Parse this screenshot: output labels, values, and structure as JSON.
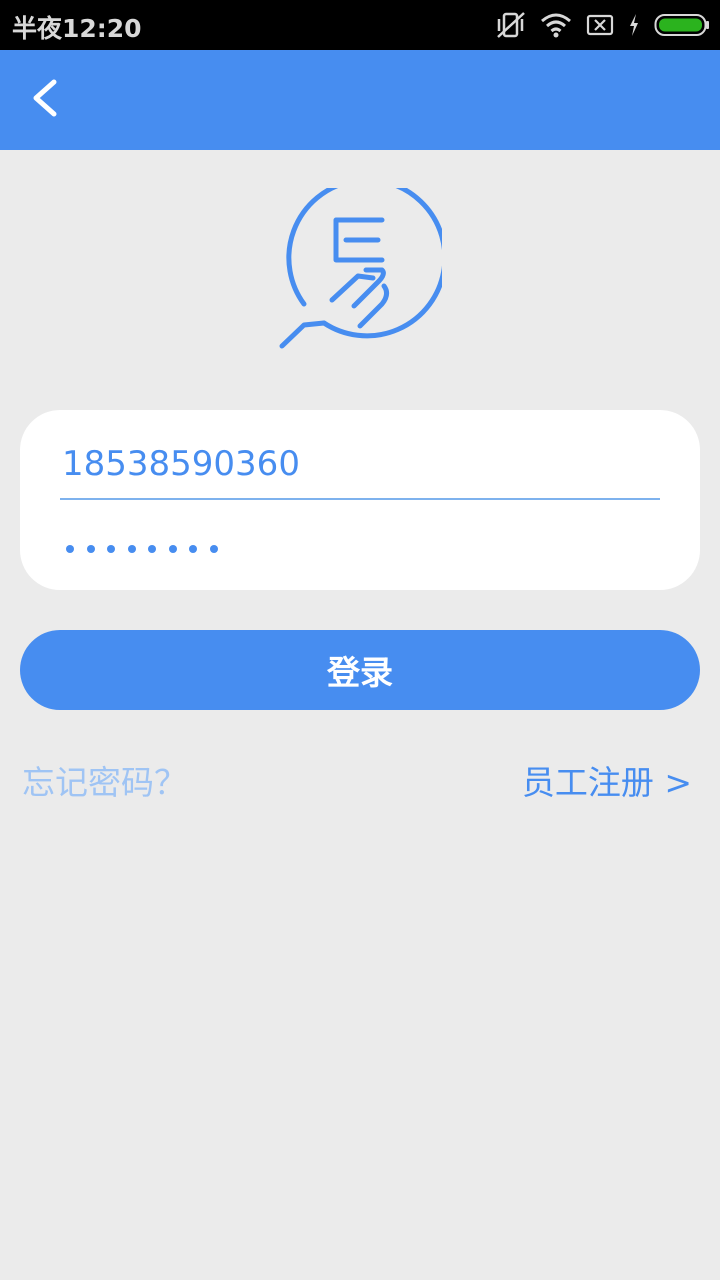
{
  "status_bar": {
    "time": "半夜12:20",
    "icons": [
      "vibrate-off-icon",
      "wifi-icon",
      "sim-off-icon",
      "charging-icon",
      "battery-icon"
    ]
  },
  "header": {
    "back_icon": "chevron-left-icon"
  },
  "logo": {
    "icon": "app-logo-icon"
  },
  "login": {
    "phone_value": "18538590360",
    "password_mask": "••••••••",
    "password_length": 8,
    "submit_label": "登录"
  },
  "links": {
    "forgot_password": "忘记密码？",
    "employee_register": "员工注册 >"
  },
  "colors": {
    "accent": "#478df0",
    "background": "#ebebeb",
    "link_muted": "#9fc4f4"
  }
}
